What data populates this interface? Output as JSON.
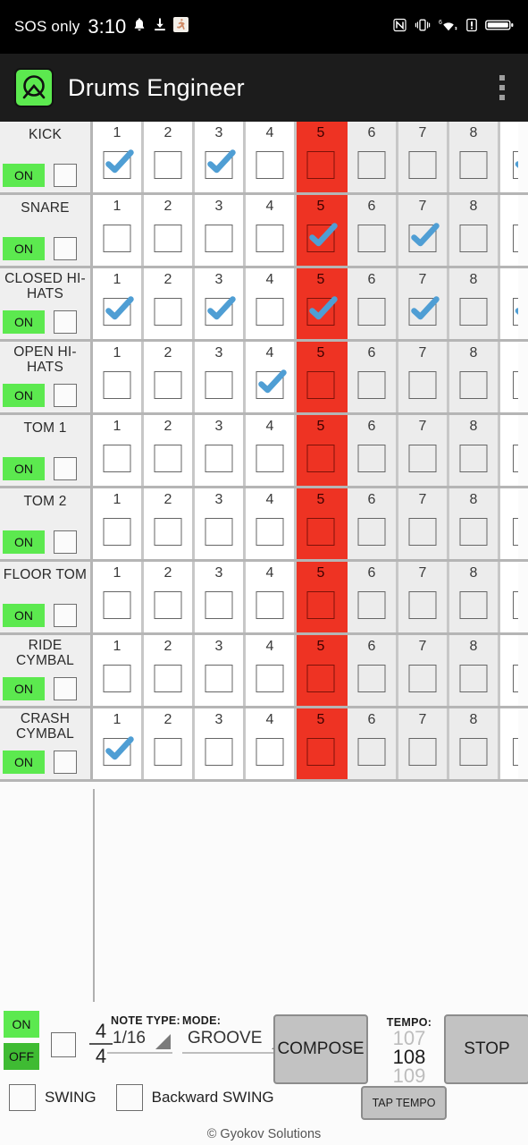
{
  "status_bar": {
    "carrier": "SOS only",
    "clock": "3:10",
    "left_icons": [
      "bell-icon",
      "download-icon",
      "running-icon"
    ],
    "right_icons": [
      "nfc-icon",
      "vibrate-icon",
      "wifi-6-icon",
      "alert-icon",
      "battery-icon"
    ]
  },
  "app_bar": {
    "title": "Drums Engineer",
    "icon": "drums-engineer-logo",
    "overflow": "overflow-menu-icon",
    "icon_color": "#5ce94f"
  },
  "grid": {
    "beat_numbers": [
      "1",
      "2",
      "3",
      "4",
      "5",
      "6",
      "7",
      "8"
    ],
    "playhead_beat": "5",
    "playhead_color": "#ee3323",
    "on_label": "ON",
    "rows": [
      {
        "name": "KICK",
        "on": "ON",
        "solo": false,
        "steps": [
          true,
          false,
          true,
          false,
          false,
          false,
          false,
          false
        ],
        "partial": true
      },
      {
        "name": "SNARE",
        "on": "ON",
        "solo": false,
        "steps": [
          false,
          false,
          false,
          false,
          true,
          false,
          true,
          false
        ],
        "partial": false
      },
      {
        "name": "CLOSED HI-HATS",
        "on": "ON",
        "solo": false,
        "steps": [
          true,
          false,
          true,
          false,
          true,
          false,
          true,
          false
        ],
        "partial": true
      },
      {
        "name": "OPEN HI-HATS",
        "on": "ON",
        "solo": false,
        "steps": [
          false,
          false,
          false,
          true,
          false,
          false,
          false,
          false
        ],
        "partial": false
      },
      {
        "name": "TOM 1",
        "on": "ON",
        "solo": false,
        "steps": [
          false,
          false,
          false,
          false,
          false,
          false,
          false,
          false
        ],
        "partial": false
      },
      {
        "name": "TOM 2",
        "on": "ON",
        "solo": false,
        "steps": [
          false,
          false,
          false,
          false,
          false,
          false,
          false,
          false
        ],
        "partial": false
      },
      {
        "name": "FLOOR TOM",
        "on": "ON",
        "solo": false,
        "steps": [
          false,
          false,
          false,
          false,
          false,
          false,
          false,
          false
        ],
        "partial": false
      },
      {
        "name": "RIDE CYMBAL",
        "on": "ON",
        "solo": false,
        "steps": [
          false,
          false,
          false,
          false,
          false,
          false,
          false,
          false
        ],
        "partial": false
      },
      {
        "name": "CRASH CYMBAL",
        "on": "ON",
        "solo": false,
        "steps": [
          true,
          false,
          false,
          false,
          false,
          false,
          false,
          false
        ],
        "partial": false
      }
    ]
  },
  "controls": {
    "metronome_on_label": "ON",
    "metronome_off_label": "OFF",
    "metronome_checkbox": false,
    "time_signature_top": "4",
    "time_signature_bottom": "4",
    "note_type_label": "NOTE TYPE:",
    "note_type_value": "1/16",
    "mode_label": "MODE:",
    "mode_value": "GROOVE",
    "compose_label": "COMPOSE",
    "stop_label": "STOP",
    "tempo_label": "TEMPO:",
    "tempo_prev": "107",
    "tempo_value": "108",
    "tempo_next": "109",
    "tap_tempo_label": "TAP TEMPO",
    "swing_label": "SWING",
    "swing_checked": false,
    "backward_swing_label": "Backward SWING",
    "backward_swing_checked": false
  },
  "footer": {
    "copyright": "© Gyokov Solutions"
  }
}
